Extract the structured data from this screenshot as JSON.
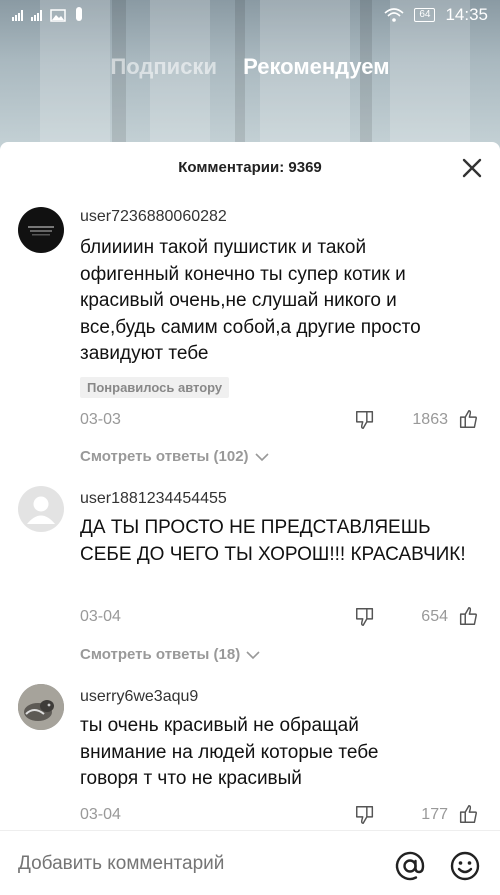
{
  "status_bar": {
    "time": "14:35",
    "battery": "64"
  },
  "top_tabs": {
    "following": "Подписки",
    "for_you": "Рекомендуем"
  },
  "sheet": {
    "title": "Комментарии: 9369"
  },
  "comments": [
    {
      "username": "user7236880060282",
      "text": "блиииин такой пушистик и такой офигенный конечно ты супер котик и красивый очень,не слушай никого и все,будь самим собой,а другие просто завидуют тебе",
      "badge": "Понравилось автору",
      "date": "03-03",
      "likes": "1863",
      "replies": "Смотреть ответы (102)"
    },
    {
      "username": "user1881234454455",
      "text": "ДА ТЫ ПРОСТО НЕ ПРЕДСТАВЛЯЕШЬ СЕБЕ ДО ЧЕГО ТЫ ХОРОШ!!! КРАСАВЧИК!",
      "date": "03-04",
      "likes": "654",
      "replies": "Смотреть ответы (18)"
    },
    {
      "username": "userry6we3aqu9",
      "text": "ты очень красивый не обращай внимание на людей которые тебе говоря т что не красивый",
      "date": "03-04",
      "likes": "177"
    }
  ],
  "input": {
    "placeholder": "Добавить комментарий"
  },
  "icons": [
    "close-icon",
    "dislike-icon",
    "like-icon",
    "chevron-down-icon",
    "at-icon",
    "emoji-icon"
  ],
  "colors": {
    "text_muted": "#999999",
    "badge_bg": "#f0f0f0"
  }
}
